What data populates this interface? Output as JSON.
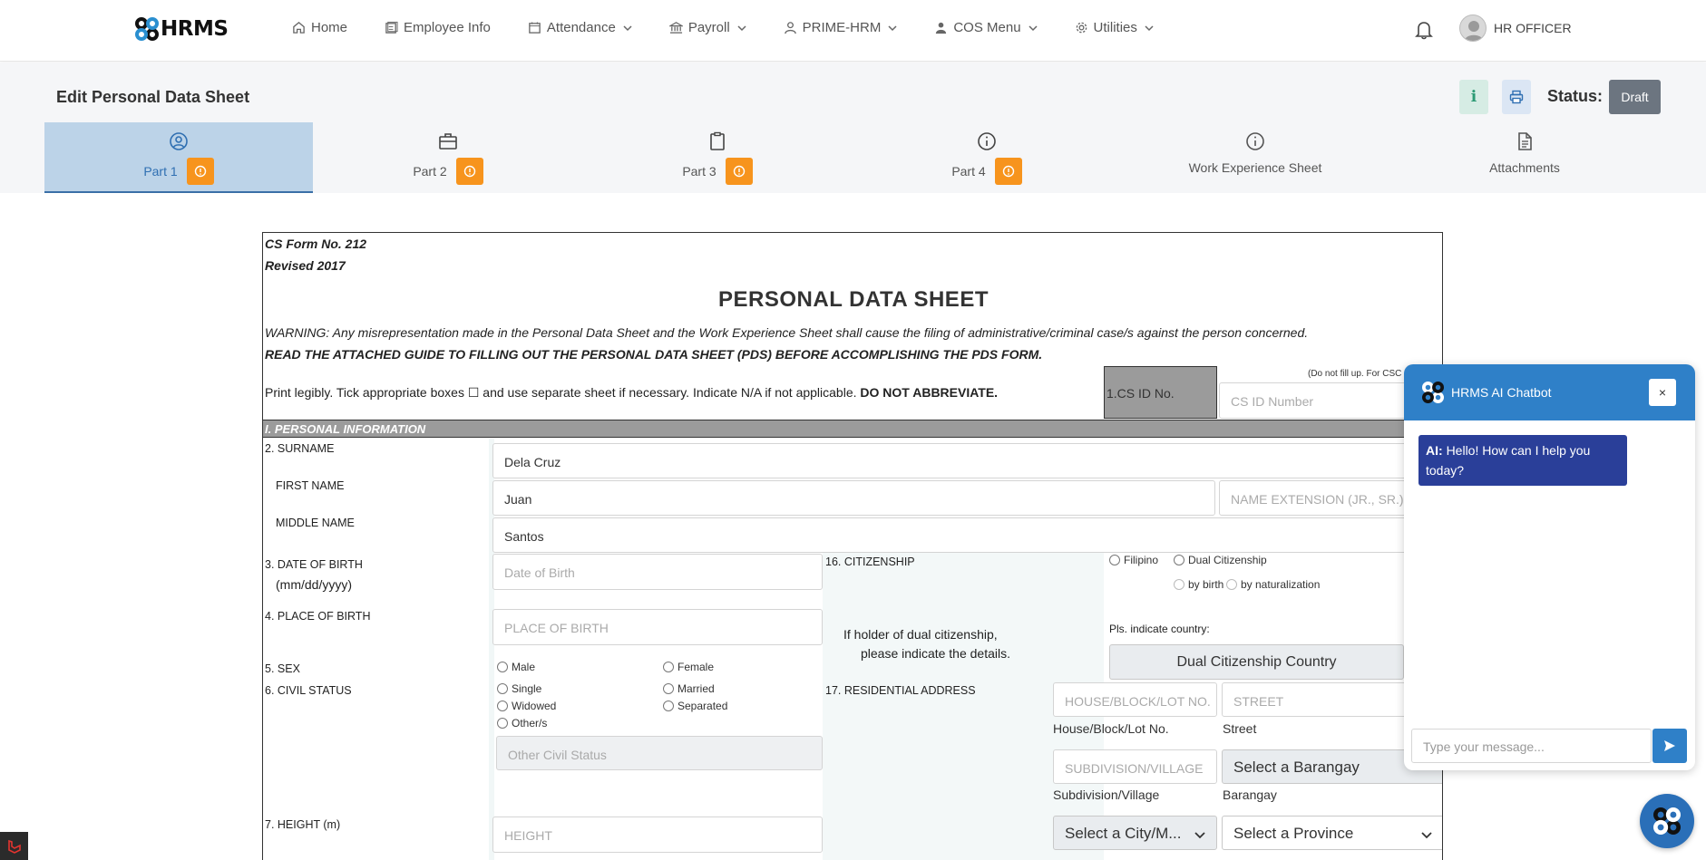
{
  "brand": {
    "logo_text": "HRMS"
  },
  "nav": {
    "items": [
      {
        "label": "Home",
        "icon": "home-icon",
        "dropdown": false
      },
      {
        "label": "Employee Info",
        "icon": "id-card-icon",
        "dropdown": false
      },
      {
        "label": "Attendance",
        "icon": "calendar-icon",
        "dropdown": true
      },
      {
        "label": "Payroll",
        "icon": "bank-icon",
        "dropdown": true
      },
      {
        "label": "PRIME-HRM",
        "icon": "user-icon",
        "dropdown": true
      },
      {
        "label": "COS Menu",
        "icon": "person-icon",
        "dropdown": true
      },
      {
        "label": "Utilities",
        "icon": "gear-icon",
        "dropdown": true
      }
    ],
    "user_name": "HR OFFICER"
  },
  "page": {
    "title": "Edit Personal Data Sheet",
    "info_button": "i",
    "status_label": "Status:",
    "status_value": "Draft"
  },
  "tabs": [
    {
      "label": "Part 1",
      "icon": "user-circle-icon",
      "warning": true,
      "active": true
    },
    {
      "label": "Part 2",
      "icon": "briefcase-icon",
      "warning": true,
      "active": false
    },
    {
      "label": "Part 3",
      "icon": "clipboard-icon",
      "warning": true,
      "active": false
    },
    {
      "label": "Part 4",
      "icon": "info-circle-icon",
      "warning": true,
      "active": false
    },
    {
      "label": "Work Experience Sheet",
      "icon": "info-circle-icon",
      "warning": false,
      "active": false
    },
    {
      "label": "Attachments",
      "icon": "document-icon",
      "warning": false,
      "active": false
    }
  ],
  "form": {
    "form_no": "CS Form No. 212",
    "revised": "Revised 2017",
    "title": "PERSONAL DATA SHEET",
    "warning": "WARNING: Any misrepresentation made in the Personal Data Sheet and the Work Experience Sheet shall cause the filing of administrative/criminal case/s against the person concerned.",
    "read_guide": "READ THE ATTACHED GUIDE TO FILLING OUT THE PERSONAL DATA SHEET (PDS) BEFORE ACCOMPLISHING THE PDS FORM.",
    "print_instructions": "Print legibly. Tick appropriate boxes ☐ and use separate sheet if necessary. Indicate N/A if not applicable.",
    "print_emphasis": "DO NOT ABBREVIATE.",
    "csc_note": "(Do not fill up. For CSC",
    "cs_id_label": "1.CS ID No.",
    "cs_id_placeholder": "CS ID Number",
    "section_title": "I. PERSONAL INFORMATION",
    "labels": {
      "surname": "2. SURNAME",
      "first_name": "FIRST NAME",
      "middle_name": "MIDDLE NAME",
      "dob": "3. DATE OF BIRTH",
      "dob_format": "(mm/dd/yyyy)",
      "pob": "4. PLACE OF BIRTH",
      "sex": "5. SEX",
      "civil_status": "6. CIVIL STATUS",
      "height": "7. HEIGHT (m)",
      "citizenship": "16. CITIZENSHIP",
      "dual_note_1": "If holder of dual citizenship,",
      "dual_note_2": "please indicate the details.",
      "indicate_country": "Pls. indicate country:",
      "residential": "17. RESIDENTIAL ADDRESS"
    },
    "values": {
      "surname": "Dela Cruz",
      "first_name": "Juan",
      "middle_name": "Santos"
    },
    "placeholders": {
      "name_ext": "NAME EXTENSION (JR., SR.)",
      "dob": "Date of Birth",
      "pob": "PLACE OF BIRTH",
      "other_civil": "Other Civil Status",
      "height": "HEIGHT",
      "house": "HOUSE/BLOCK/LOT NO.",
      "street": "STREET",
      "subdivision": "SUBDIVISION/VILLAGE"
    },
    "sex_options": [
      "Male",
      "Female"
    ],
    "civil_options": [
      "Single",
      "Married",
      "Widowed",
      "Separated",
      "Other/s"
    ],
    "citizenship_options": [
      "Filipino",
      "Dual Citizenship"
    ],
    "dual_options": [
      "by birth",
      "by naturalization"
    ],
    "dual_country_button": "Dual Citizenship Country",
    "address_sublabels": {
      "house": "House/Block/Lot No.",
      "street": "Street",
      "subdivision": "Subdivision/Village",
      "barangay": "Barangay"
    },
    "selects": {
      "barangay": "Select a Barangay",
      "city": "Select a City/M...",
      "province": "Select a Province"
    }
  },
  "chatbot": {
    "title": "HRMS AI Chatbot",
    "close": "×",
    "ai_prefix": "AI:",
    "message": "Hello! How can I help you today?",
    "input_placeholder": "Type your message..."
  },
  "colors": {
    "accent": "#2f80c8",
    "warning": "#f7941d",
    "active_tab": "#bcd3e8",
    "status_badge": "#6c7580",
    "section_bar": "#9b9b9b"
  }
}
